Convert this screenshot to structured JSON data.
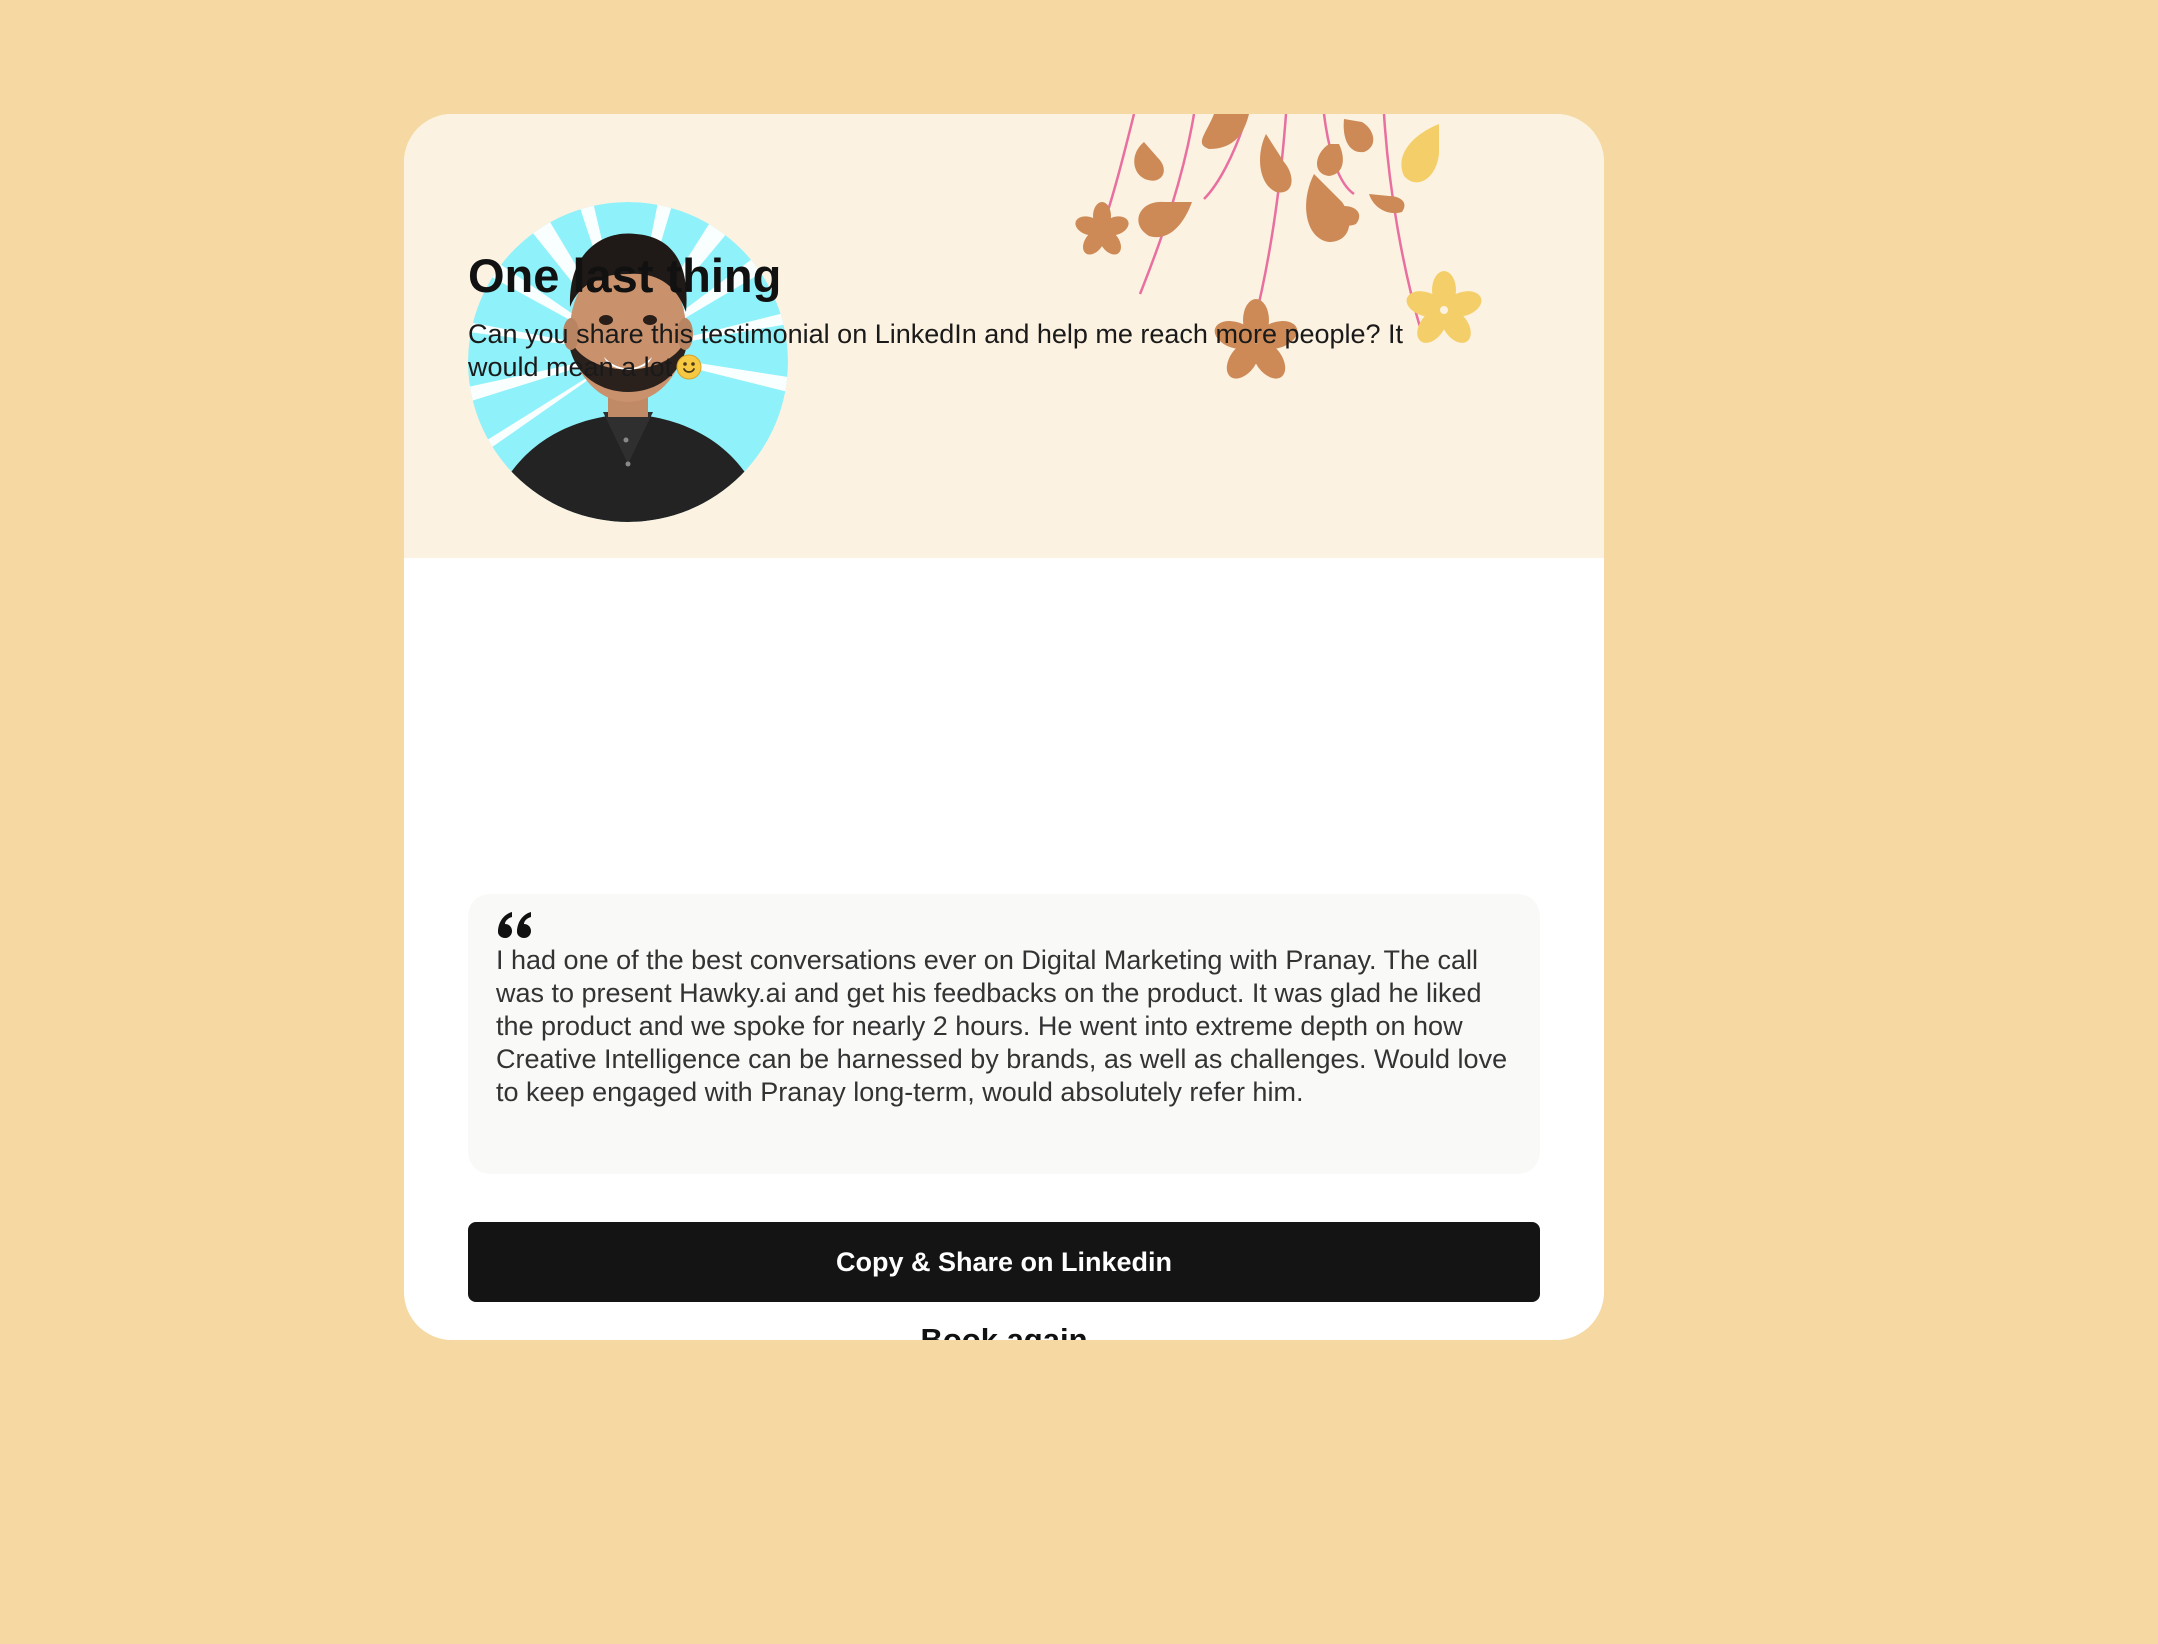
{
  "card": {
    "title": "One last thing",
    "subtitle": "Can you share this testimonial on LinkedIn and help me reach more people? It would mean a lot",
    "subtitle_emoji": "slightly-smiling-face-icon"
  },
  "testimonial": {
    "quote_icon": "quote-open-icon",
    "text": "I had one of the best conversations ever on Digital Marketing with Pranay. The call was to present Hawky.ai and get his feedbacks on the product. It was glad he liked the product and we spoke for nearly 2 hours. He went into extreme depth on how Creative Intelligence can be harnessed by brands, as well as challenges. Would love to keep engaged with Pranay long-term, would absolutely refer him."
  },
  "actions": {
    "share_label": "Copy & Share on Linkedin",
    "book_label": "Book again"
  },
  "colors": {
    "page_background": "#f6d8a2",
    "hero_background": "#fcf2e1",
    "button_background": "#141414",
    "quote_background": "#f9f9f8",
    "floral_brown": "#cd8a57",
    "floral_yellow": "#f4cf69",
    "floral_stem": "#e86f9f",
    "avatar_burst": "#8ff1f9"
  }
}
